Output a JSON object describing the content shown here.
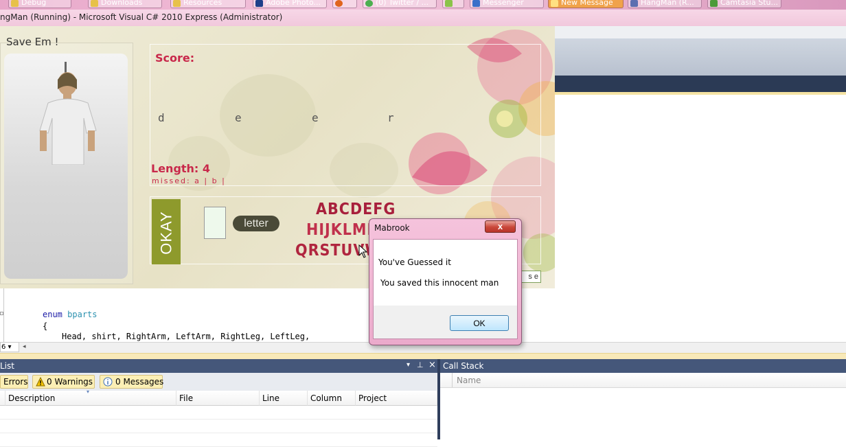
{
  "taskbar": {
    "items": [
      {
        "label": "Debug"
      },
      {
        "label": "Downloads"
      },
      {
        "label": "Resources"
      },
      {
        "label": "Adobe Photo..."
      },
      {
        "label": ""
      },
      {
        "label": "(0) Twitter / ..."
      },
      {
        "label": ""
      },
      {
        "label": "Messenger"
      },
      {
        "label": "New Message"
      },
      {
        "label": "HangMan (R..."
      },
      {
        "label": "Camtasia Stu..."
      }
    ]
  },
  "window": {
    "title": "ngMan (Running) - Microsoft Visual C# 2010 Express (Administrator)"
  },
  "hangman": {
    "save_label": "Save Em !",
    "score_label": "Score:",
    "word_letters": [
      "d",
      "e",
      "e",
      "r"
    ],
    "length_label": "Length: 4",
    "missed_label": "missed: a | b |",
    "okay_label": "OKAY",
    "letter_button": "letter",
    "alphabet_row1": "ABCDEFG",
    "alphabet_row2": "HIJKLMN",
    "alphabet_row3": "QRSTUVW",
    "close_label": "se",
    "alphabet_color": "#b0253f",
    "accent_color": "#c8284a"
  },
  "code": {
    "line1_kw": "enum",
    "line1_type": "bparts",
    "line2": "{",
    "line3": "Head, shirt, RightArm, LeftArm, RightLeg, LeftLeg,",
    "zoom": "6"
  },
  "error_list": {
    "title": "List",
    "errors_tab": "Errors",
    "warnings_tab": "0 Warnings",
    "messages_tab": "0 Messages",
    "columns": [
      "Description",
      "File",
      "Line",
      "Column",
      "Project"
    ]
  },
  "call_stack": {
    "title": "Call Stack",
    "column": "Name"
  },
  "msgbox": {
    "title": "Mabrook",
    "close": "x",
    "line1": "You've Guessed it",
    "line2": "You saved this innocent man",
    "ok": "OK"
  }
}
